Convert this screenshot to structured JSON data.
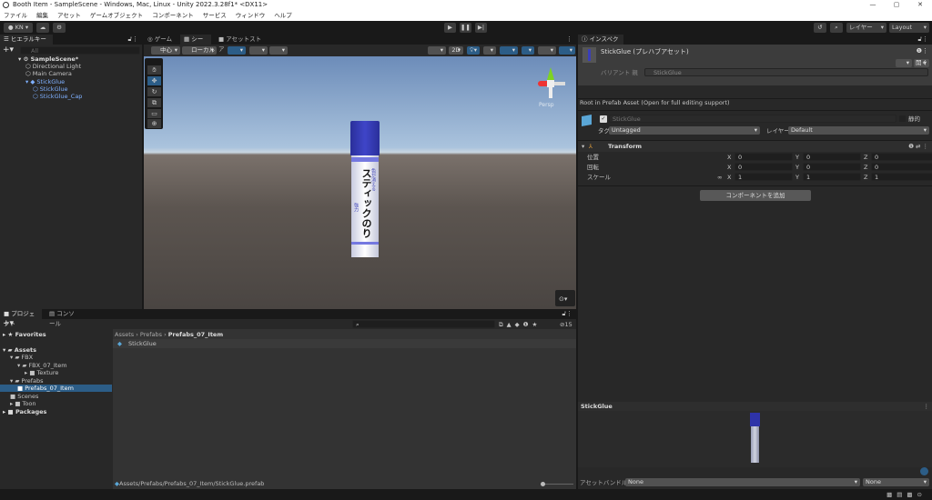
{
  "window": {
    "title": "Booth Item - SampleScene - Windows, Mac, Linux - Unity 2022.3.28f1* <DX11>",
    "controls": [
      "—",
      "▢",
      "✕"
    ]
  },
  "menu": [
    "ファイル",
    "編集",
    "アセット",
    "ゲームオブジェクト",
    "コンポーネント",
    "サービス",
    "ウィンドウ",
    "ヘルプ"
  ],
  "toolbar": {
    "account": "KN",
    "layers": "レイヤー",
    "layout": "Layout"
  },
  "hierarchy": {
    "tab": "ヒエラルキー",
    "search_placeholder": "All",
    "scene": "SampleScene*",
    "items": [
      {
        "label": "Directional Light",
        "depth": 1,
        "prefab": false
      },
      {
        "label": "Main Camera",
        "depth": 1,
        "prefab": false
      },
      {
        "label": "StickGlue",
        "depth": 1,
        "prefab": true
      },
      {
        "label": "StickGlue",
        "depth": 2,
        "prefab": true
      },
      {
        "label": "StickGlue_Cap",
        "depth": 2,
        "prefab": true
      }
    ]
  },
  "scene": {
    "tabs": [
      "ゲーム",
      "シーン",
      "アセットストア"
    ],
    "active_tab": "シーン",
    "pivot": "中心",
    "space": "ローカル",
    "mode_2d": "2D",
    "persp": "Persp",
    "product_label": "スティックのり",
    "product_sub1": "色が消える",
    "product_sub2": "強力"
  },
  "inspector": {
    "tab": "インスペクター",
    "asset_title": "StickGlue (プレハブアセット)",
    "open_button": "開く",
    "variant_label": "バリアント 親",
    "variant_value": "StickGlue",
    "root_note": "Root in Prefab Asset (Open for full editing support)",
    "name": "StickGlue",
    "static_label": "静的",
    "tag_label": "タグ",
    "tag_value": "Untagged",
    "layer_label": "レイヤー",
    "layer_value": "Default",
    "transform": {
      "title": "Transform",
      "rows": [
        {
          "label": "位置",
          "x": "0",
          "y": "0",
          "z": "0"
        },
        {
          "label": "回転",
          "x": "0",
          "y": "0",
          "z": "0"
        },
        {
          "label": "スケール",
          "x": "1",
          "y": "1",
          "z": "1"
        }
      ]
    },
    "add_component": "コンポーネントを追加",
    "preview_title": "StickGlue",
    "asset_bundle_label": "アセットバンドル",
    "asset_bundle_value": "None",
    "asset_bundle_variant": "None"
  },
  "project": {
    "tabs": [
      "プロジェクト",
      "コンソール"
    ],
    "hidden_count": "15",
    "tree": [
      {
        "label": "Favorites",
        "depth": 0,
        "bold": true,
        "selected": false
      },
      {
        "label": "Assets",
        "depth": 0,
        "bold": true,
        "selected": false
      },
      {
        "label": "FBX",
        "depth": 1,
        "bold": false,
        "selected": false
      },
      {
        "label": "FBX_07_Item",
        "depth": 2,
        "bold": false,
        "selected": false
      },
      {
        "label": "Texture",
        "depth": 3,
        "bold": false,
        "selected": false
      },
      {
        "label": "Prefabs",
        "depth": 1,
        "bold": false,
        "selected": false
      },
      {
        "label": "Prefabs_07_Item",
        "depth": 2,
        "bold": false,
        "selected": true
      },
      {
        "label": "Scenes",
        "depth": 1,
        "bold": false,
        "selected": false
      },
      {
        "label": "Toon",
        "depth": 1,
        "bold": false,
        "selected": false
      },
      {
        "label": "Packages",
        "depth": 0,
        "bold": true,
        "selected": false
      }
    ],
    "breadcrumb": [
      "Assets",
      "Prefabs",
      "Prefabs_07_Item"
    ],
    "files": [
      "StickGlue"
    ],
    "status_path": "Assets/Prefabs/Prefabs_07_Item/StickGlue.prefab"
  },
  "colors": {
    "accent": "#2c5d87",
    "prefab_blue": "#7fb0ff",
    "glue_cap": "#3439b8"
  }
}
